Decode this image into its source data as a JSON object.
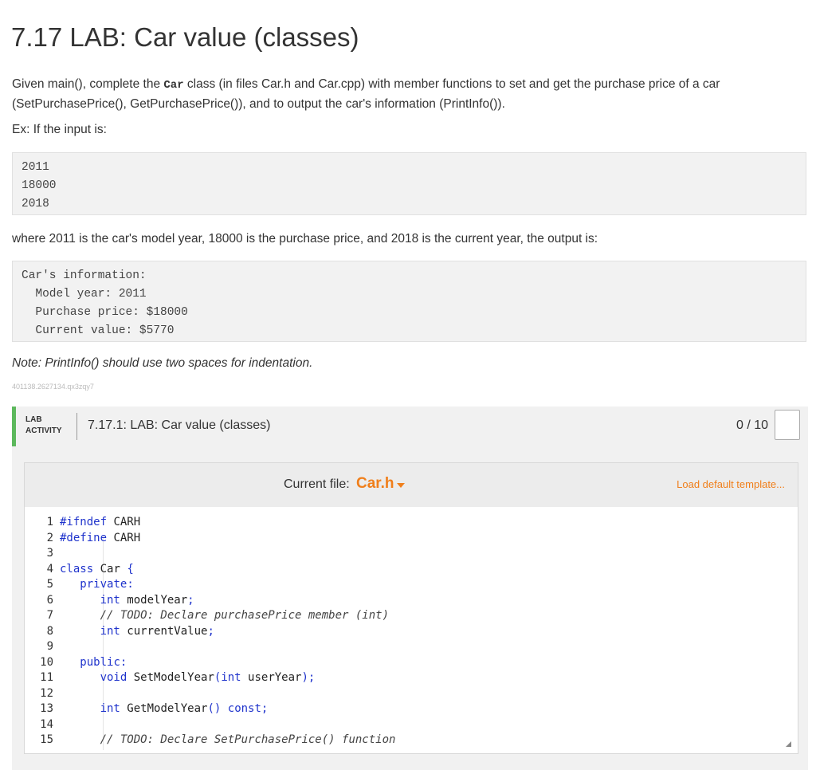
{
  "page": {
    "title": "7.17 LAB: Car value (classes)",
    "intro_before": "Given main(), complete the ",
    "intro_code": "Car",
    "intro_after": " class (in files Car.h and Car.cpp) with member functions to set and get the purchase price of a car",
    "intro_line2": "(SetPurchasePrice(), GetPurchasePrice()), and to output the car's information (PrintInfo()).",
    "example_lead": "Ex: If the input is:",
    "input_lines": [
      "2011",
      "18000",
      "2018"
    ],
    "where_text": "where 2011 is the car's model year, 18000 is the purchase price, and 2018 is the current year, the output is:",
    "output_lines": [
      "Car's information:",
      "  Model year: 2011",
      "  Purchase price: $18000",
      "  Current value: $5770"
    ],
    "note": "Note: PrintInfo() should use two spaces for indentation.",
    "content_id": "401138.2627134.qx3zqy7"
  },
  "lab": {
    "tag_line1": "LAB",
    "tag_line2": "ACTIVITY",
    "title": "7.17.1: LAB: Car value (classes)",
    "score": "0 / 10"
  },
  "editor": {
    "current_file_label": "Current file:",
    "current_file": "Car.h",
    "load_template": "Load default template...",
    "lines": [
      {
        "n": "1",
        "t": "#ifndef CARH"
      },
      {
        "n": "2",
        "t": "#define CARH"
      },
      {
        "n": "3",
        "t": ""
      },
      {
        "n": "4",
        "t": "class Car {"
      },
      {
        "n": "5",
        "t": "   private:"
      },
      {
        "n": "6",
        "t": "      int modelYear;"
      },
      {
        "n": "7",
        "t": "      // TODO: Declare purchasePrice member (int)"
      },
      {
        "n": "8",
        "t": "      int currentValue;"
      },
      {
        "n": "9",
        "t": ""
      },
      {
        "n": "10",
        "t": "   public:"
      },
      {
        "n": "11",
        "t": "      void SetModelYear(int userYear);"
      },
      {
        "n": "12",
        "t": ""
      },
      {
        "n": "13",
        "t": "      int GetModelYear() const;"
      },
      {
        "n": "14",
        "t": ""
      },
      {
        "n": "15",
        "t": "      // TODO: Declare SetPurchasePrice() function"
      }
    ]
  }
}
